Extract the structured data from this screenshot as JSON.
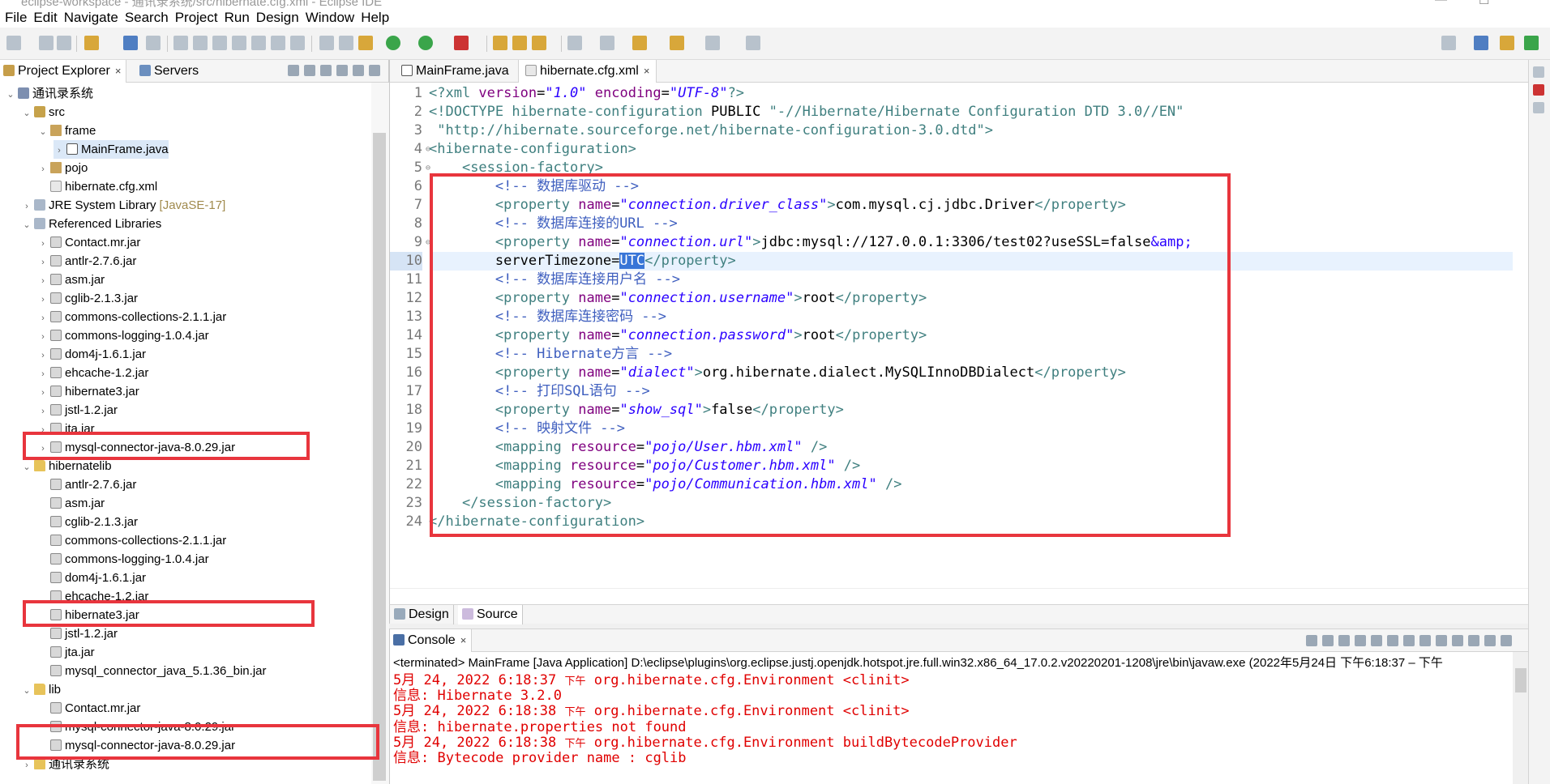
{
  "window": {
    "title": "eclipse-workspace - 通讯录系统/src/hibernate.cfg.xml - Eclipse IDE"
  },
  "menu": [
    "File",
    "Edit",
    "Navigate",
    "Search",
    "Project",
    "Run",
    "Design",
    "Window",
    "Help"
  ],
  "explorer": {
    "tabs": [
      {
        "label": "Project Explorer",
        "close": "×"
      },
      {
        "label": "Servers"
      }
    ],
    "tree": [
      {
        "label": "通讯录系统",
        "icon": "project-icon",
        "depth": 0,
        "expanded": true
      },
      {
        "label": "src",
        "icon": "source-folder-icon",
        "depth": 1,
        "expanded": true
      },
      {
        "label": "frame",
        "icon": "package-icon",
        "depth": 2,
        "expanded": true
      },
      {
        "label": "MainFrame.java",
        "icon": "java-file-icon",
        "depth": 3,
        "expanded": false,
        "selected": true
      },
      {
        "label": "pojo",
        "icon": "package-icon",
        "depth": 2,
        "expanded": false
      },
      {
        "label": "hibernate.cfg.xml",
        "icon": "xml-file-icon",
        "depth": 2,
        "leaf": true
      },
      {
        "label": "JRE System Library",
        "suffix": "[JavaSE-17]",
        "icon": "library-icon",
        "depth": 1,
        "expanded": false
      },
      {
        "label": "Referenced Libraries",
        "icon": "library-icon",
        "depth": 1,
        "expanded": true
      },
      {
        "label": "Contact.mr.jar",
        "icon": "jar-icon",
        "depth": 2,
        "expanded": false
      },
      {
        "label": "antlr-2.7.6.jar",
        "icon": "jar-icon",
        "depth": 2,
        "expanded": false
      },
      {
        "label": "asm.jar",
        "icon": "jar-icon",
        "depth": 2,
        "expanded": false
      },
      {
        "label": "cglib-2.1.3.jar",
        "icon": "jar-icon",
        "depth": 2,
        "expanded": false
      },
      {
        "label": "commons-collections-2.1.1.jar",
        "icon": "jar-icon",
        "depth": 2,
        "expanded": false
      },
      {
        "label": "commons-logging-1.0.4.jar",
        "icon": "jar-icon",
        "depth": 2,
        "expanded": false
      },
      {
        "label": "dom4j-1.6.1.jar",
        "icon": "jar-icon",
        "depth": 2,
        "expanded": false
      },
      {
        "label": "ehcache-1.2.jar",
        "icon": "jar-icon",
        "depth": 2,
        "expanded": false
      },
      {
        "label": "hibernate3.jar",
        "icon": "jar-icon",
        "depth": 2,
        "expanded": false
      },
      {
        "label": "jstl-1.2.jar",
        "icon": "jar-icon",
        "depth": 2,
        "expanded": false
      },
      {
        "label": "jta.jar",
        "icon": "jar-icon",
        "depth": 2,
        "expanded": false
      },
      {
        "label": "mysql-connector-java-8.0.29.jar",
        "icon": "jar-icon",
        "depth": 2,
        "expanded": false
      },
      {
        "label": "hibernatelib",
        "icon": "folder-icon",
        "depth": 1,
        "expanded": true
      },
      {
        "label": "antlr-2.7.6.jar",
        "icon": "jar-icon",
        "depth": 2,
        "leaf": true
      },
      {
        "label": "asm.jar",
        "icon": "jar-icon",
        "depth": 2,
        "leaf": true
      },
      {
        "label": "cglib-2.1.3.jar",
        "icon": "jar-icon",
        "depth": 2,
        "leaf": true
      },
      {
        "label": "commons-collections-2.1.1.jar",
        "icon": "jar-icon",
        "depth": 2,
        "leaf": true
      },
      {
        "label": "commons-logging-1.0.4.jar",
        "icon": "jar-icon",
        "depth": 2,
        "leaf": true
      },
      {
        "label": "dom4j-1.6.1.jar",
        "icon": "jar-icon",
        "depth": 2,
        "leaf": true
      },
      {
        "label": "ehcache-1.2.jar",
        "icon": "jar-icon",
        "depth": 2,
        "leaf": true
      },
      {
        "label": "hibernate3.jar",
        "icon": "jar-icon",
        "depth": 2,
        "leaf": true
      },
      {
        "label": "jstl-1.2.jar",
        "icon": "jar-icon",
        "depth": 2,
        "leaf": true
      },
      {
        "label": "jta.jar",
        "icon": "jar-icon",
        "depth": 2,
        "leaf": true
      },
      {
        "label": "mysql_connector_java_5.1.36_bin.jar",
        "icon": "jar-icon",
        "depth": 2,
        "leaf": true
      },
      {
        "label": "lib",
        "icon": "folder-icon",
        "depth": 1,
        "expanded": true
      },
      {
        "label": "Contact.mr.jar",
        "icon": "jar-icon",
        "depth": 2,
        "leaf": true
      },
      {
        "label": "mysql-connector-java-8.0.29.jar",
        "icon": "jar-icon",
        "depth": 2,
        "leaf": true
      },
      {
        "label": "mysql-connector-java-8.0.29.jar",
        "icon": "jar-icon",
        "depth": 2,
        "leaf": true
      },
      {
        "label": "通讯录系统",
        "icon": "folder-icon",
        "depth": 1,
        "expanded": false
      }
    ]
  },
  "editor": {
    "tabs": [
      {
        "label": "MainFrame.java",
        "icon": "java-file-icon",
        "active": false
      },
      {
        "label": "hibernate.cfg.xml",
        "icon": "xml-file-icon",
        "active": true,
        "close": "×"
      }
    ],
    "current_line": 10,
    "lines": [
      {
        "n": "1",
        "fold": "",
        "segs": [
          [
            "pi",
            "<?xml "
          ],
          [
            "an",
            "version"
          ],
          [
            "tx",
            "="
          ],
          [
            "av",
            "\"1.0\""
          ],
          [
            "tx",
            " "
          ],
          [
            "an",
            "encoding"
          ],
          [
            "tx",
            "="
          ],
          [
            "av",
            "\"UTF-8\""
          ],
          [
            "pi",
            "?>"
          ]
        ]
      },
      {
        "n": "2",
        "fold": "",
        "segs": [
          [
            "tag",
            "<!DOCTYPE hibernate-configuration "
          ],
          [
            "tx",
            "PUBLIC "
          ],
          [
            "tag",
            "\"-//Hibernate/Hibernate Configuration DTD 3.0//EN\""
          ]
        ]
      },
      {
        "n": "3",
        "fold": "",
        "segs": [
          [
            "tag",
            " \"http://hibernate.sourceforge.net/hibernate-configuration-3.0.dtd\">"
          ]
        ]
      },
      {
        "n": "4",
        "fold": "⊖",
        "segs": [
          [
            "tag",
            "<hibernate-configuration>"
          ]
        ]
      },
      {
        "n": "5",
        "fold": "⊖",
        "segs": [
          [
            "tx",
            "    "
          ],
          [
            "tag",
            "<session-factory>"
          ]
        ]
      },
      {
        "n": "6",
        "fold": "",
        "segs": [
          [
            "tx",
            "        "
          ],
          [
            "cm",
            "<!-- 数据库驱动 -->"
          ]
        ]
      },
      {
        "n": "7",
        "fold": "",
        "segs": [
          [
            "tx",
            "        "
          ],
          [
            "tag",
            "<property "
          ],
          [
            "an",
            "name"
          ],
          [
            "tx",
            "="
          ],
          [
            "av",
            "\"connection.driver_class\""
          ],
          [
            "tag",
            ">"
          ],
          [
            "tx",
            "com.mysql.cj.jdbc.Driver"
          ],
          [
            "tag",
            "</property>"
          ]
        ]
      },
      {
        "n": "8",
        "fold": "",
        "segs": [
          [
            "tx",
            "        "
          ],
          [
            "cm",
            "<!-- 数据库连接的URL -->"
          ]
        ]
      },
      {
        "n": "9",
        "fold": "⊖",
        "segs": [
          [
            "tx",
            "        "
          ],
          [
            "tag",
            "<property "
          ],
          [
            "an",
            "name"
          ],
          [
            "tx",
            "="
          ],
          [
            "av",
            "\"connection.url\""
          ],
          [
            "tag",
            ">"
          ],
          [
            "tx",
            "jdbc:mysql://127.0.0.1:3306/test02?useSSL=false"
          ],
          [
            "ent",
            "&amp;"
          ]
        ]
      },
      {
        "n": "10",
        "fold": "",
        "segs": [
          [
            "tx",
            "        serverTimezone="
          ],
          [
            "sel",
            "UTC"
          ],
          [
            "tag",
            "</property>"
          ]
        ]
      },
      {
        "n": "11",
        "fold": "",
        "segs": [
          [
            "tx",
            "        "
          ],
          [
            "cm",
            "<!-- 数据库连接用户名 -->"
          ]
        ]
      },
      {
        "n": "12",
        "fold": "",
        "segs": [
          [
            "tx",
            "        "
          ],
          [
            "tag",
            "<property "
          ],
          [
            "an",
            "name"
          ],
          [
            "tx",
            "="
          ],
          [
            "av",
            "\"connection.username\""
          ],
          [
            "tag",
            ">"
          ],
          [
            "tx",
            "root"
          ],
          [
            "tag",
            "</property>"
          ]
        ]
      },
      {
        "n": "13",
        "fold": "",
        "segs": [
          [
            "tx",
            "        "
          ],
          [
            "cm",
            "<!-- 数据库连接密码 -->"
          ]
        ]
      },
      {
        "n": "14",
        "fold": "",
        "segs": [
          [
            "tx",
            "        "
          ],
          [
            "tag",
            "<property "
          ],
          [
            "an",
            "name"
          ],
          [
            "tx",
            "="
          ],
          [
            "av",
            "\"connection.password\""
          ],
          [
            "tag",
            ">"
          ],
          [
            "tx",
            "root"
          ],
          [
            "tag",
            "</property>"
          ]
        ]
      },
      {
        "n": "15",
        "fold": "",
        "segs": [
          [
            "tx",
            "        "
          ],
          [
            "cm",
            "<!-- Hibernate方言 -->"
          ]
        ]
      },
      {
        "n": "16",
        "fold": "",
        "segs": [
          [
            "tx",
            "        "
          ],
          [
            "tag",
            "<property "
          ],
          [
            "an",
            "name"
          ],
          [
            "tx",
            "="
          ],
          [
            "av",
            "\"dialect\""
          ],
          [
            "tag",
            ">"
          ],
          [
            "tx",
            "org.hibernate.dialect.MySQLInnoDBDialect"
          ],
          [
            "tag",
            "</property>"
          ]
        ]
      },
      {
        "n": "17",
        "fold": "",
        "segs": [
          [
            "tx",
            "        "
          ],
          [
            "cm",
            "<!-- 打印SQL语句 -->"
          ]
        ]
      },
      {
        "n": "18",
        "fold": "",
        "segs": [
          [
            "tx",
            "        "
          ],
          [
            "tag",
            "<property "
          ],
          [
            "an",
            "name"
          ],
          [
            "tx",
            "="
          ],
          [
            "av",
            "\"show_sql\""
          ],
          [
            "tag",
            ">"
          ],
          [
            "tx",
            "false"
          ],
          [
            "tag",
            "</property>"
          ]
        ]
      },
      {
        "n": "19",
        "fold": "",
        "segs": [
          [
            "tx",
            "        "
          ],
          [
            "cm",
            "<!-- 映射文件 -->"
          ]
        ]
      },
      {
        "n": "20",
        "fold": "",
        "segs": [
          [
            "tx",
            "        "
          ],
          [
            "tag",
            "<mapping "
          ],
          [
            "an",
            "resource"
          ],
          [
            "tx",
            "="
          ],
          [
            "av",
            "\"pojo/User.hbm.xml\""
          ],
          [
            "tag",
            " />"
          ]
        ]
      },
      {
        "n": "21",
        "fold": "",
        "segs": [
          [
            "tx",
            "        "
          ],
          [
            "tag",
            "<mapping "
          ],
          [
            "an",
            "resource"
          ],
          [
            "tx",
            "="
          ],
          [
            "av",
            "\"pojo/Customer.hbm.xml\""
          ],
          [
            "tag",
            " />"
          ]
        ]
      },
      {
        "n": "22",
        "fold": "",
        "segs": [
          [
            "tx",
            "        "
          ],
          [
            "tag",
            "<mapping "
          ],
          [
            "an",
            "resource"
          ],
          [
            "tx",
            "="
          ],
          [
            "av",
            "\"pojo/Communication.hbm.xml\""
          ],
          [
            "tag",
            " />"
          ]
        ]
      },
      {
        "n": "23",
        "fold": "",
        "segs": [
          [
            "tx",
            "    "
          ],
          [
            "tag",
            "</session-factory>"
          ]
        ]
      },
      {
        "n": "24",
        "fold": "",
        "segs": [
          [
            "tag",
            "</hibernate-configuration>"
          ]
        ]
      }
    ],
    "bottom_tabs": [
      {
        "label": "Design",
        "active": false
      },
      {
        "label": "Source",
        "active": true
      }
    ]
  },
  "console": {
    "tab": {
      "label": "Console",
      "close": "×"
    },
    "terminated": "<terminated> MainFrame [Java Application] D:\\eclipse\\plugins\\org.eclipse.justj.openjdk.hotspot.jre.full.win32.x86_64_17.0.2.v20220201-1208\\jre\\bin\\javaw.exe  (2022年5月24日 下午6:18:37 – 下午",
    "lines": [
      {
        "pre": "5月 24, 2022 6:18:37 ",
        "cn": "下午",
        "post": " org.hibernate.cfg.Environment <clinit>"
      },
      {
        "pre": "信息: Hibernate 3.2.0",
        "cn": "",
        "post": ""
      },
      {
        "pre": "5月 24, 2022 6:18:38 ",
        "cn": "下午",
        "post": " org.hibernate.cfg.Environment <clinit>"
      },
      {
        "pre": "信息: hibernate.properties not found",
        "cn": "",
        "post": ""
      },
      {
        "pre": "5月 24, 2022 6:18:38 ",
        "cn": "下午",
        "post": " org.hibernate.cfg.Environment buildBytecodeProvider"
      },
      {
        "pre": "信息: Bytecode provider name : cglib",
        "cn": "",
        "post": ""
      }
    ]
  },
  "colors": {
    "highlight_box": "#e8353d",
    "console_text": "#e00000",
    "selection": "#3875d7"
  }
}
